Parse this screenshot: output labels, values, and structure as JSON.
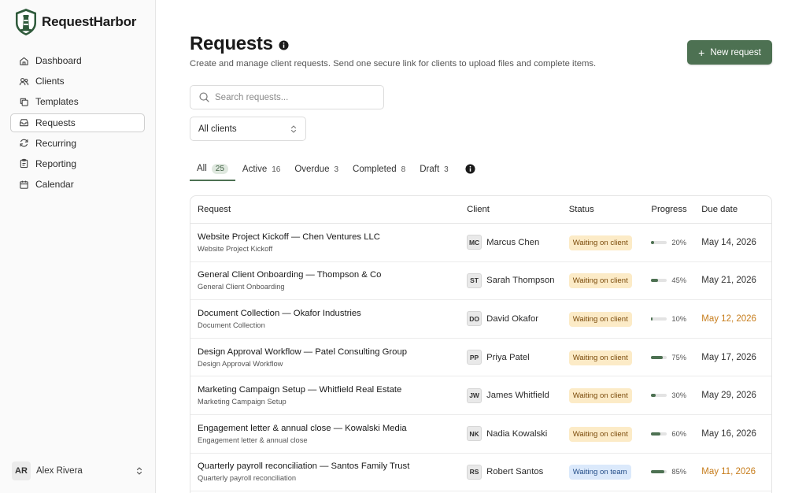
{
  "brand": {
    "name": "RequestHarbor"
  },
  "nav": [
    {
      "label": "Dashboard",
      "icon": "home-icon",
      "active": false
    },
    {
      "label": "Clients",
      "icon": "users-icon",
      "active": false
    },
    {
      "label": "Templates",
      "icon": "copy-icon",
      "active": false
    },
    {
      "label": "Requests",
      "icon": "inbox-icon",
      "active": true
    },
    {
      "label": "Recurring",
      "icon": "refresh-icon",
      "active": false
    },
    {
      "label": "Reporting",
      "icon": "clipboard-icon",
      "active": false
    },
    {
      "label": "Calendar",
      "icon": "calendar-icon",
      "active": false
    }
  ],
  "user": {
    "initials": "AR",
    "name": "Alex Rivera"
  },
  "page": {
    "title": "Requests",
    "subtitle": "Create and manage client requests. Send one secure link for clients to upload files and complete items.",
    "new_button": "New request"
  },
  "search": {
    "placeholder": "Search requests..."
  },
  "filter": {
    "selected": "All clients"
  },
  "tabs": [
    {
      "label": "All",
      "count": "25",
      "active": true
    },
    {
      "label": "Active",
      "count": "16",
      "active": false
    },
    {
      "label": "Overdue",
      "count": "3",
      "active": false
    },
    {
      "label": "Completed",
      "count": "8",
      "active": false
    },
    {
      "label": "Draft",
      "count": "3",
      "active": false
    }
  ],
  "table": {
    "headers": {
      "request": "Request",
      "client": "Client",
      "status": "Status",
      "progress": "Progress",
      "due": "Due date"
    },
    "rows": [
      {
        "title": "Website Project Kickoff — Chen Ventures LLC",
        "template": "Website Project Kickoff",
        "initials": "MC",
        "client": "Marcus Chen",
        "status": "Waiting on client",
        "status_kind": "waiting-client",
        "progress": 20,
        "progress_label": "20%",
        "due": "May 14, 2026",
        "overdue": false
      },
      {
        "title": "General Client Onboarding — Thompson & Co",
        "template": "General Client Onboarding",
        "initials": "ST",
        "client": "Sarah Thompson",
        "status": "Waiting on client",
        "status_kind": "waiting-client",
        "progress": 45,
        "progress_label": "45%",
        "due": "May 21, 2026",
        "overdue": false
      },
      {
        "title": "Document Collection — Okafor Industries",
        "template": "Document Collection",
        "initials": "DO",
        "client": "David Okafor",
        "status": "Waiting on client",
        "status_kind": "waiting-client",
        "progress": 10,
        "progress_label": "10%",
        "due": "May 12, 2026",
        "overdue": true
      },
      {
        "title": "Design Approval Workflow — Patel Consulting Group",
        "template": "Design Approval Workflow",
        "initials": "PP",
        "client": "Priya Patel",
        "status": "Waiting on client",
        "status_kind": "waiting-client",
        "progress": 75,
        "progress_label": "75%",
        "due": "May 17, 2026",
        "overdue": false
      },
      {
        "title": "Marketing Campaign Setup — Whitfield Real Estate",
        "template": "Marketing Campaign Setup",
        "initials": "JW",
        "client": "James Whitfield",
        "status": "Waiting on client",
        "status_kind": "waiting-client",
        "progress": 30,
        "progress_label": "30%",
        "due": "May 29, 2026",
        "overdue": false
      },
      {
        "title": "Engagement letter & annual close — Kowalski Media",
        "template": "Engagement letter & annual close",
        "initials": "NK",
        "client": "Nadia Kowalski",
        "status": "Waiting on client",
        "status_kind": "waiting-client",
        "progress": 60,
        "progress_label": "60%",
        "due": "May 16, 2026",
        "overdue": false
      },
      {
        "title": "Quarterly payroll reconciliation — Santos Family Trust",
        "template": "Quarterly payroll reconciliation",
        "initials": "RS",
        "client": "Robert Santos",
        "status": "Waiting on team",
        "status_kind": "waiting-team",
        "progress": 85,
        "progress_label": "85%",
        "due": "May 11, 2026",
        "overdue": true
      }
    ]
  },
  "colors": {
    "accent": "#4d7152",
    "overdue": "#c77d1c",
    "waiting_client_bg": "#fcebc7",
    "waiting_team_bg": "#dbe9fb"
  }
}
